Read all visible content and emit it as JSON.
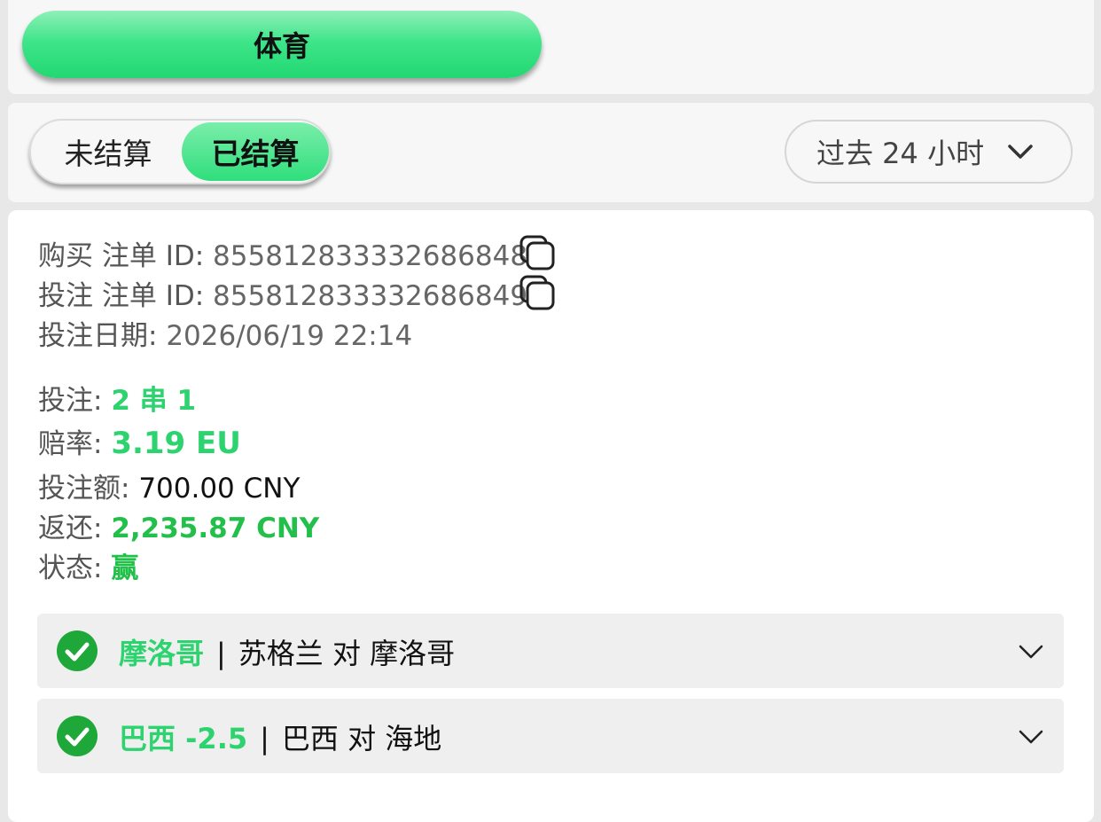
{
  "header": {
    "sport_label": "体育"
  },
  "filter": {
    "tabs": [
      "未结算",
      "已结算"
    ],
    "active_tab": "已结算",
    "time_range": "过去 24 小时"
  },
  "bet": {
    "purchase_id_label": "购买 注单 ID: ",
    "purchase_id": "855812833332686848",
    "bet_id_label": "投注 注单 ID: ",
    "bet_id": "855812833332686849",
    "date_label": "投注日期: ",
    "date": "2026/06/19 22:14",
    "type_label": "投注: ",
    "type": "2 串 1",
    "odds_label": "赔率: ",
    "odds": "3.19 EU",
    "stake_label": "投注额: ",
    "stake": "700.00 CNY",
    "return_label": "返还: ",
    "return": "2,235.87 CNY",
    "status_label": "状态: ",
    "status": "赢",
    "legs": [
      {
        "selection": "摩洛哥",
        "separator": "|",
        "match": "苏格兰 对 摩洛哥"
      },
      {
        "selection": "巴西 -2.5",
        "separator": "|",
        "match": "巴西 对 海地"
      }
    ]
  },
  "colors": {
    "accent_green": "#2cd36e",
    "win_green": "#22c04a",
    "check_green": "#1fa83a"
  }
}
